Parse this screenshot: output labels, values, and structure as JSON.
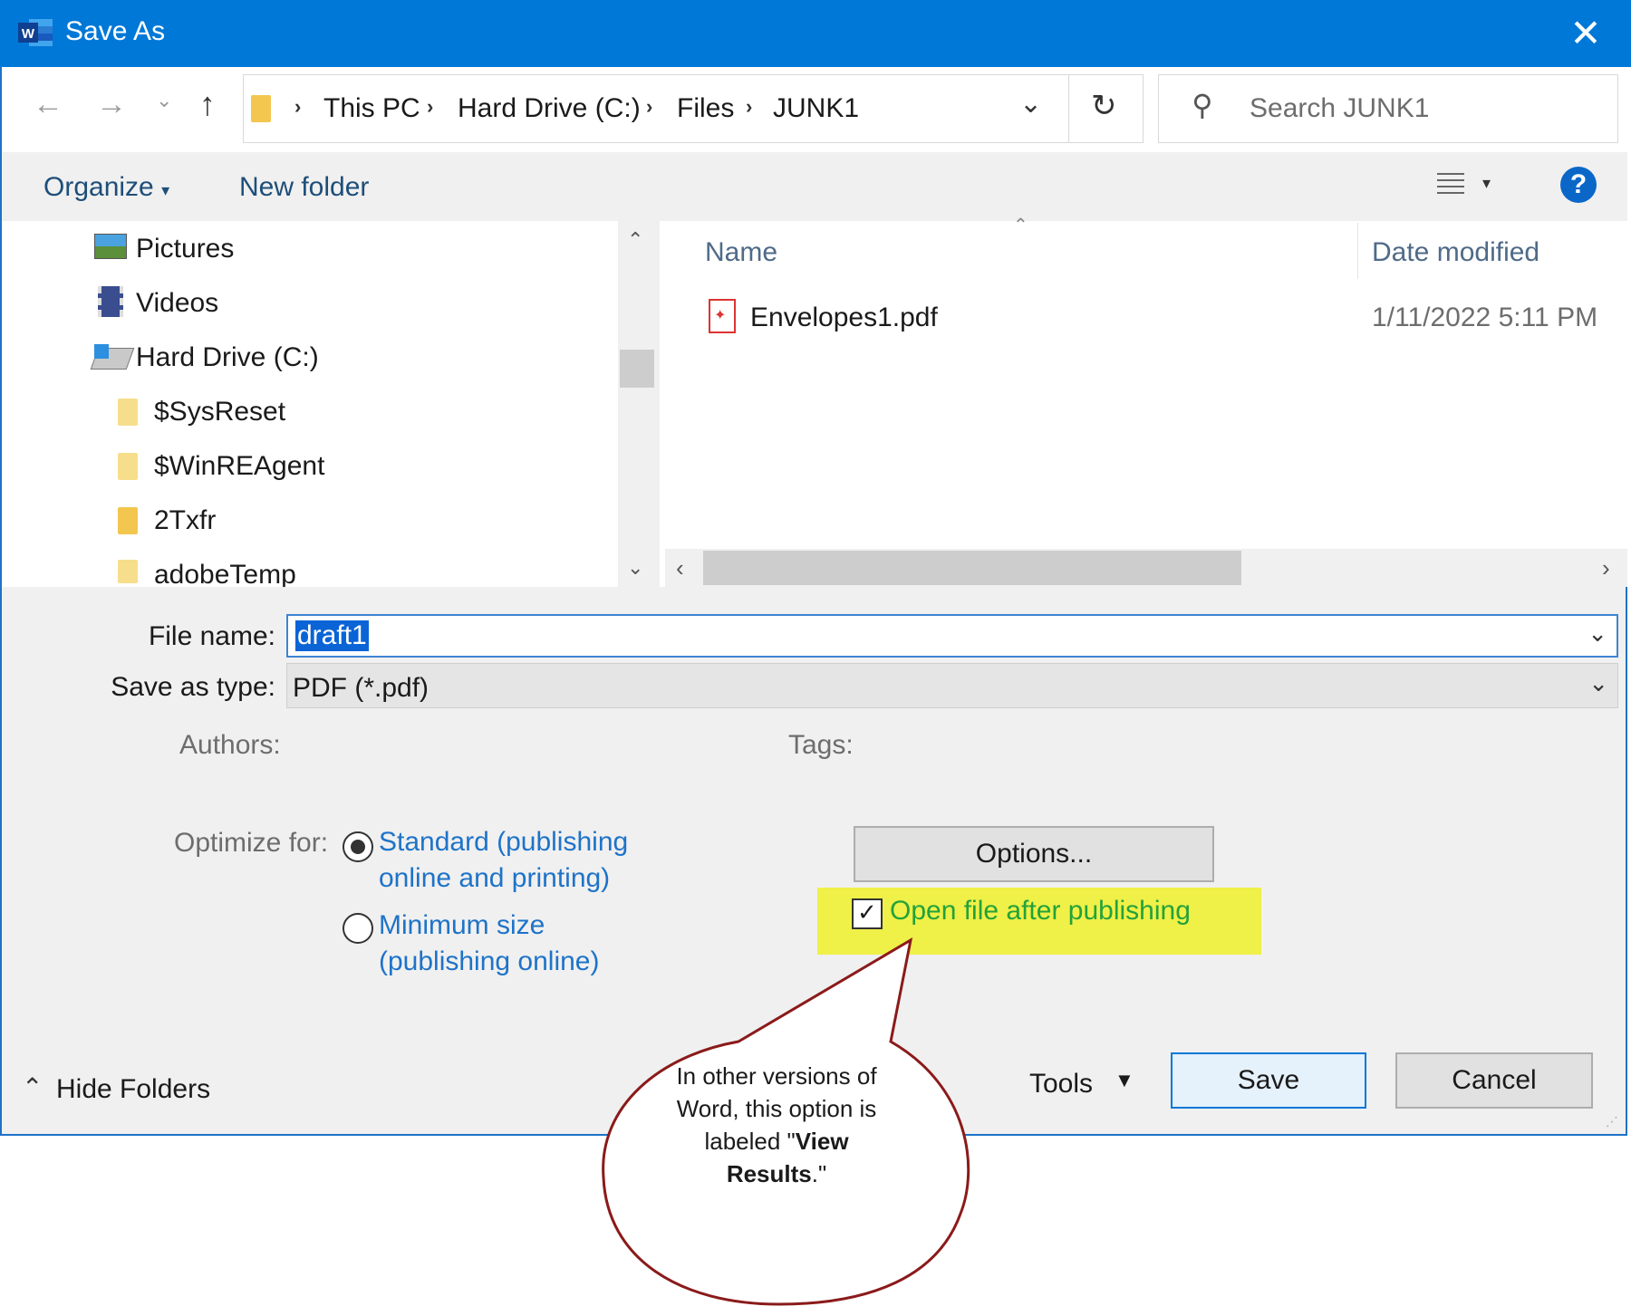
{
  "window": {
    "title": "Save As",
    "close_label": "✕"
  },
  "address": {
    "crumbs": [
      "This PC",
      "Hard Drive (C:)",
      "Files",
      "JUNK1"
    ],
    "search_placeholder": "Search JUNK1"
  },
  "toolbar": {
    "organize": "Organize",
    "new_folder": "New folder",
    "help": "?"
  },
  "nav_tree": {
    "items": [
      {
        "label": "Pictures"
      },
      {
        "label": "Videos"
      },
      {
        "label": "Hard Drive (C:)"
      },
      {
        "label": "$SysReset"
      },
      {
        "label": "$WinREAgent"
      },
      {
        "label": "2Txfr"
      },
      {
        "label": "adobeTemp"
      }
    ]
  },
  "file_list": {
    "columns": [
      "Name",
      "Date modified"
    ],
    "rows": [
      {
        "name": "Envelopes1.pdf",
        "date": "1/11/2022 5:11 PM"
      }
    ]
  },
  "form": {
    "file_name_label": "File name:",
    "file_name_value": "draft1",
    "save_type_label": "Save as type:",
    "save_type_value": "PDF (*.pdf)",
    "authors_label": "Authors:",
    "tags_label": "Tags:",
    "optimize_label": "Optimize for:",
    "opt_standard_1": "Standard (publishing",
    "opt_standard_2": "online and printing)",
    "opt_min_1": "Minimum size",
    "opt_min_2": "(publishing online)",
    "options_button": "Options...",
    "open_after": "Open file after publishing"
  },
  "footer": {
    "hide_folders": "Hide Folders",
    "tools": "Tools",
    "save": "Save",
    "cancel": "Cancel"
  },
  "callout": {
    "line1": "In other versions of",
    "line2": "Word, this option is",
    "line3a": "labeled \"",
    "line3b": "View",
    "line4a": "Results",
    "line4b": ".\""
  },
  "colors": {
    "titlebar": "#0078d7",
    "highlight": "#eff048",
    "link": "#1e73c8",
    "callout_border": "#8b1a1a"
  }
}
